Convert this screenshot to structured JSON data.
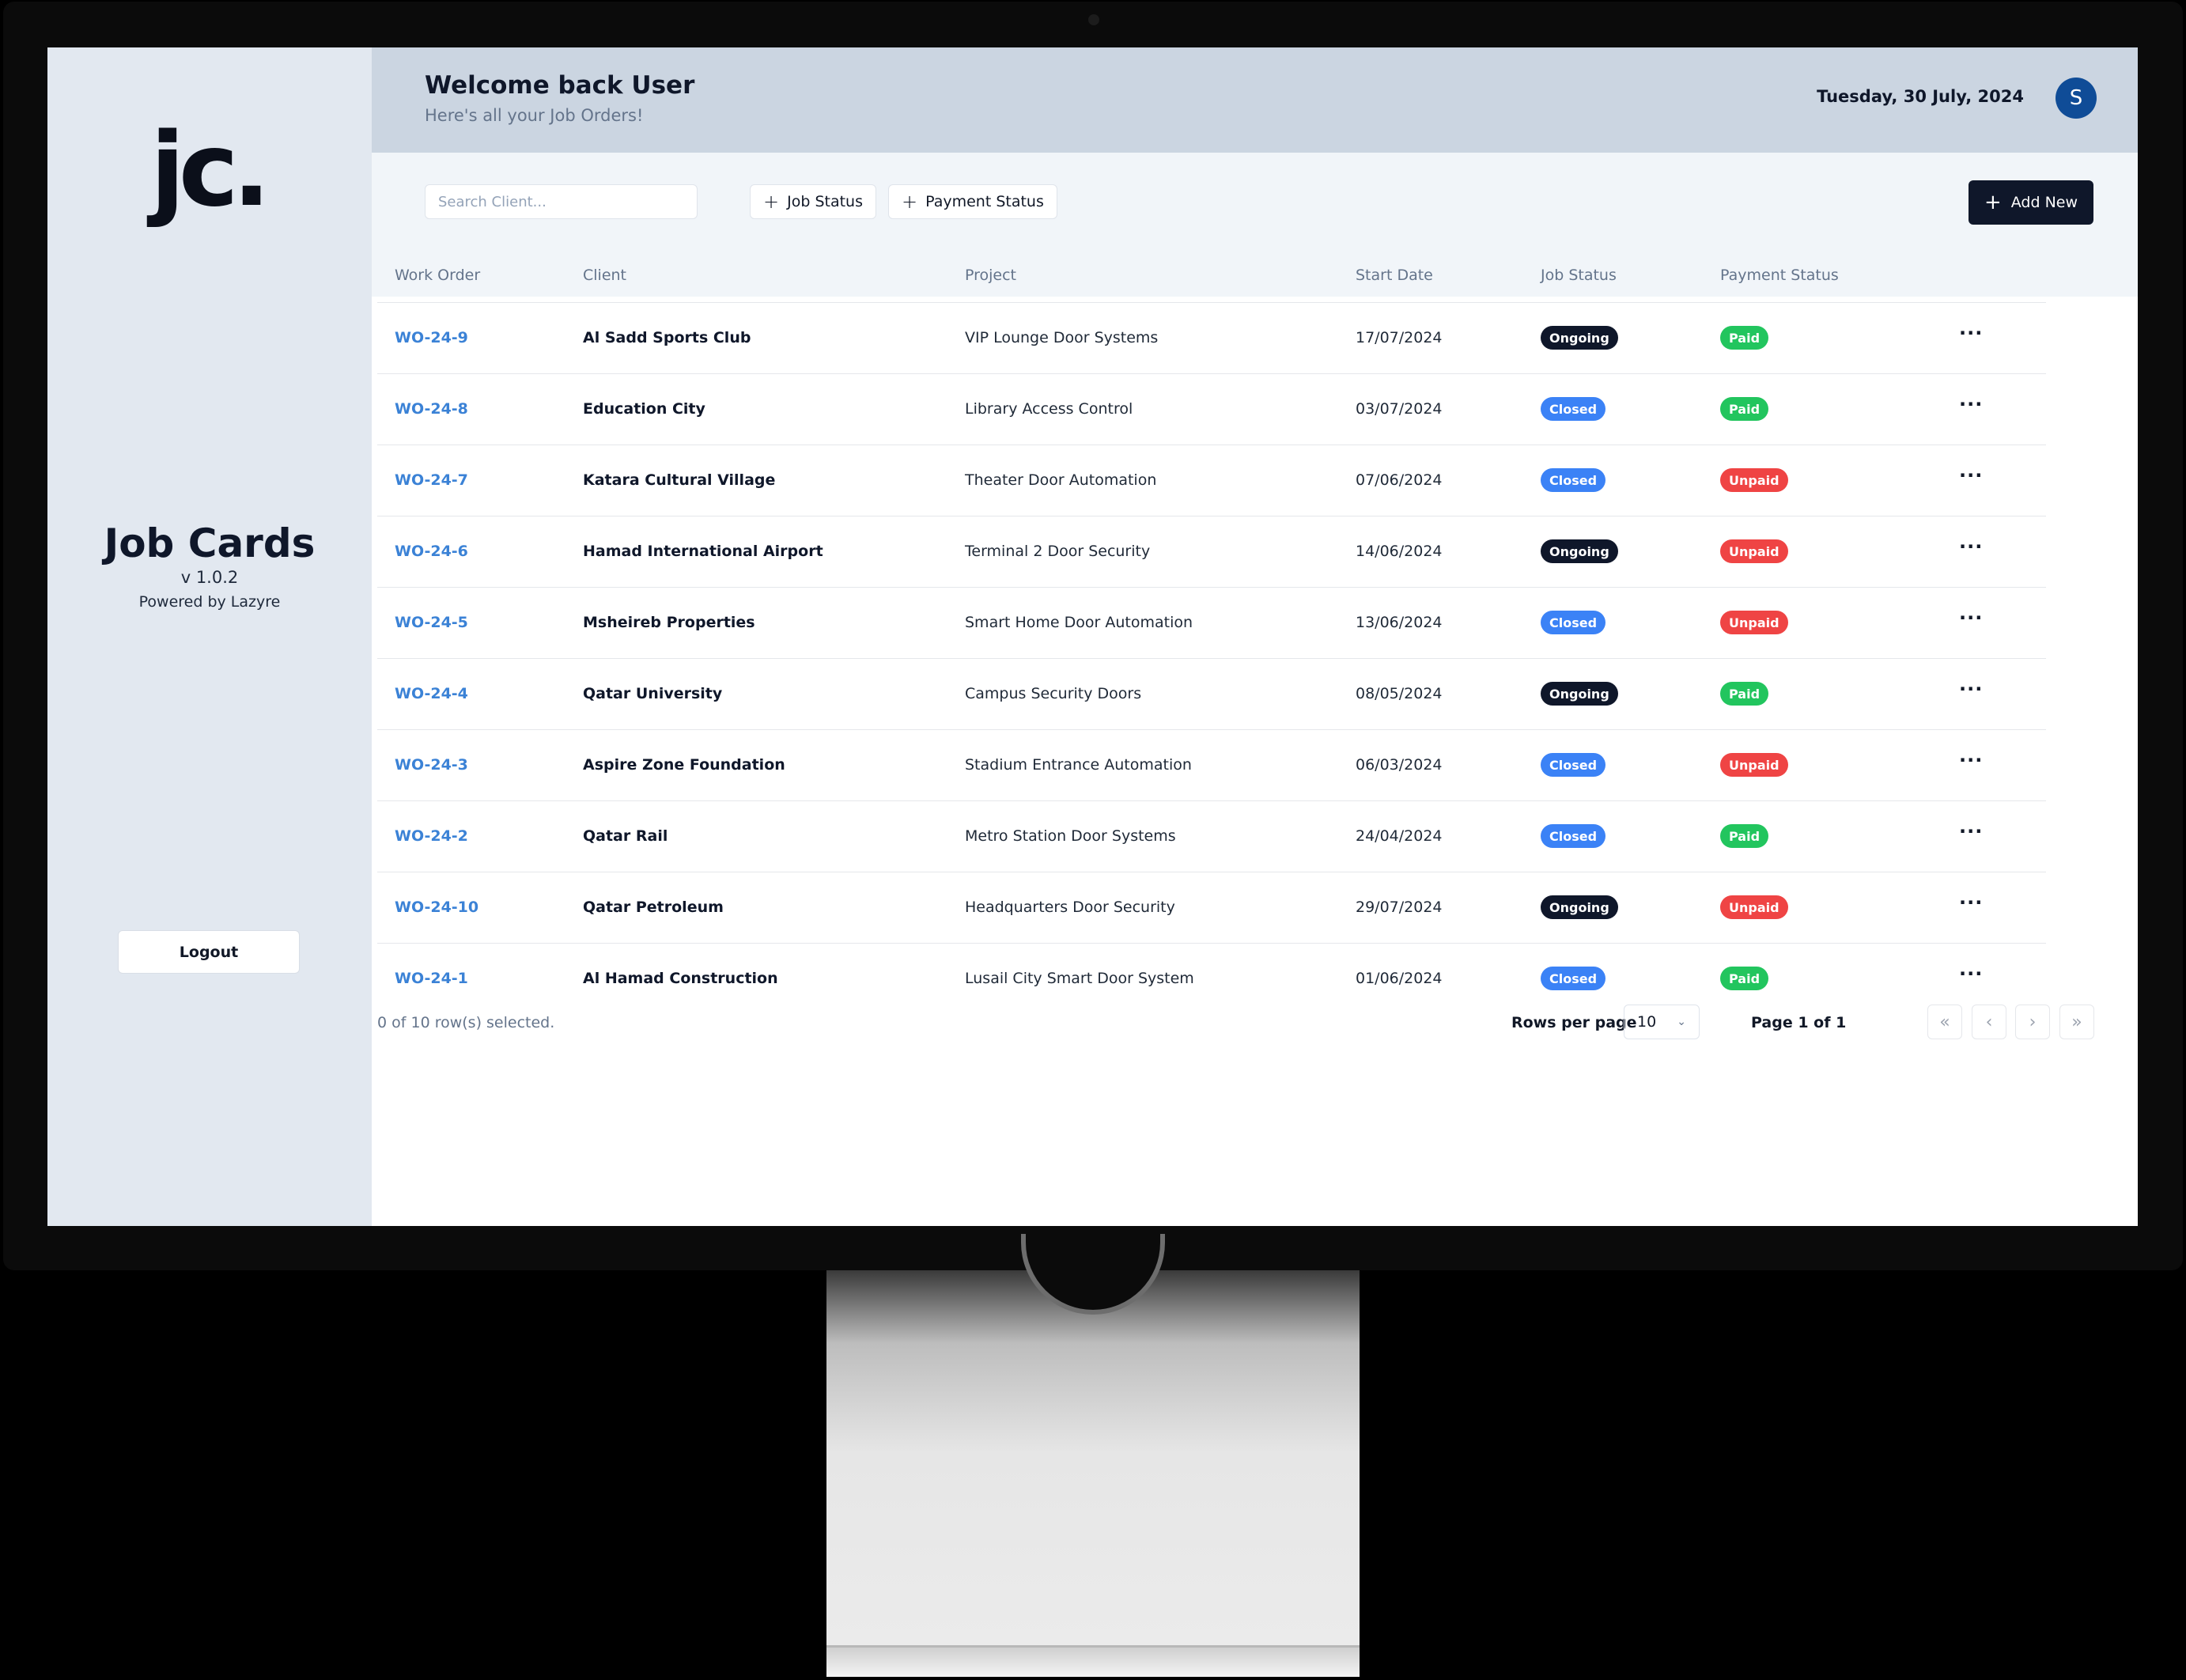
{
  "app": {
    "logo_text": "jc.",
    "title": "Job Cards",
    "version": "v 1.0.2",
    "powered_by": "Powered by Lazyre",
    "logout_label": "Logout"
  },
  "header": {
    "welcome": "Welcome back User",
    "subtitle": "Here's all your Job Orders!",
    "date": "Tuesday, 30 July, 2024",
    "avatar_initial": "S"
  },
  "toolbar": {
    "search_placeholder": "Search Client...",
    "filter_job_status": "Job Status",
    "filter_payment_status": "Payment Status",
    "add_new_label": "Add New",
    "plus_icon": "+"
  },
  "table": {
    "columns": {
      "work_order": "Work Order",
      "client": "Client",
      "project": "Project",
      "start_date": "Start Date",
      "job_status": "Job Status",
      "payment_status": "Payment Status"
    },
    "rows": [
      {
        "wo": "WO-24-9",
        "client": "Al Sadd Sports Club",
        "project": "VIP Lounge Door Systems",
        "date": "17/07/2024",
        "job": "Ongoing",
        "pay": "Paid"
      },
      {
        "wo": "WO-24-8",
        "client": "Education City",
        "project": "Library Access Control",
        "date": "03/07/2024",
        "job": "Closed",
        "pay": "Paid"
      },
      {
        "wo": "WO-24-7",
        "client": "Katara Cultural Village",
        "project": "Theater Door Automation",
        "date": "07/06/2024",
        "job": "Closed",
        "pay": "Unpaid"
      },
      {
        "wo": "WO-24-6",
        "client": "Hamad International Airport",
        "project": "Terminal 2 Door Security",
        "date": "14/06/2024",
        "job": "Ongoing",
        "pay": "Unpaid"
      },
      {
        "wo": "WO-24-5",
        "client": "Msheireb Properties",
        "project": "Smart Home Door Automation",
        "date": "13/06/2024",
        "job": "Closed",
        "pay": "Unpaid"
      },
      {
        "wo": "WO-24-4",
        "client": "Qatar University",
        "project": "Campus Security Doors",
        "date": "08/05/2024",
        "job": "Ongoing",
        "pay": "Paid"
      },
      {
        "wo": "WO-24-3",
        "client": "Aspire Zone Foundation",
        "project": "Stadium Entrance Automation",
        "date": "06/03/2024",
        "job": "Closed",
        "pay": "Unpaid"
      },
      {
        "wo": "WO-24-2",
        "client": "Qatar Rail",
        "project": "Metro Station Door Systems",
        "date": "24/04/2024",
        "job": "Closed",
        "pay": "Paid"
      },
      {
        "wo": "WO-24-10",
        "client": "Qatar Petroleum",
        "project": "Headquarters Door Security",
        "date": "29/07/2024",
        "job": "Ongoing",
        "pay": "Unpaid"
      },
      {
        "wo": "WO-24-1",
        "client": "Al Hamad Construction",
        "project": "Lusail City Smart Door System",
        "date": "01/06/2024",
        "job": "Closed",
        "pay": "Paid"
      }
    ],
    "row_menu_icon": "···"
  },
  "footer": {
    "selected": "0 of 10 row(s) selected.",
    "rows_per_page_label": "Rows per page",
    "rows_per_page_value": "10",
    "page_label": "Page 1 of 1",
    "first_icon": "«",
    "prev_icon": "‹",
    "next_icon": "›",
    "last_icon": "»",
    "chevron_icon": "⌄"
  },
  "colors": {
    "Ongoing": "#0f172a",
    "Closed": "#3b82f6",
    "Paid": "#22c55e",
    "Unpaid": "#ef4444"
  }
}
